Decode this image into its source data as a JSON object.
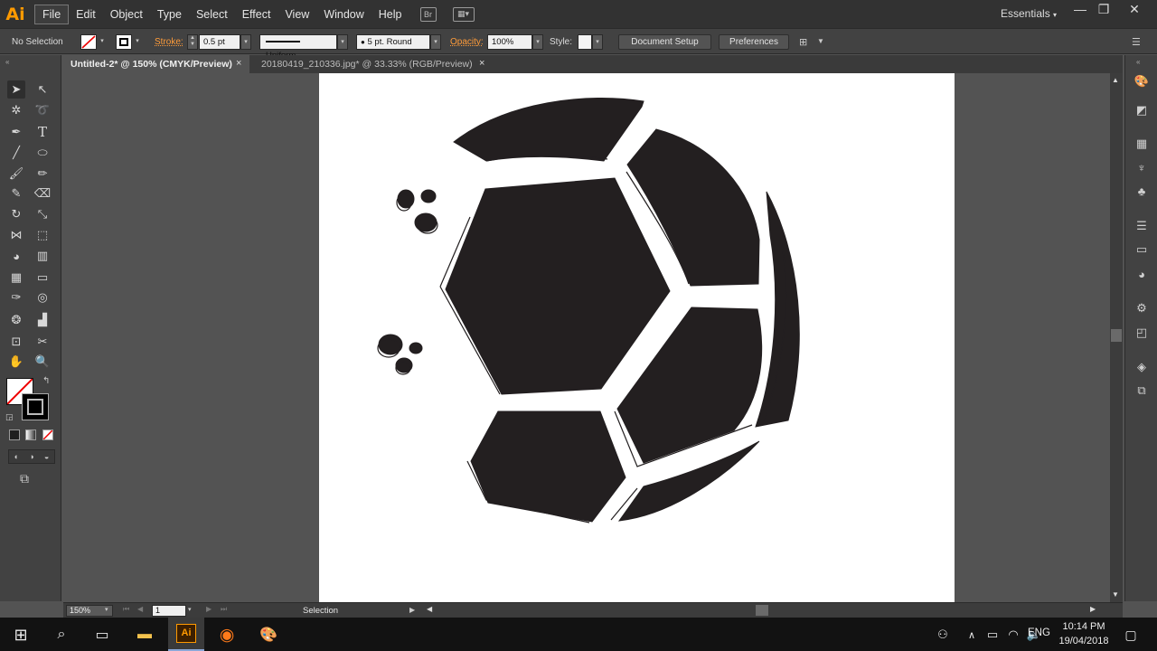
{
  "app": {
    "logo": "Ai",
    "workspace": "Essentials"
  },
  "menu": [
    "File",
    "Edit",
    "Object",
    "Type",
    "Select",
    "Effect",
    "View",
    "Window",
    "Help"
  ],
  "menu_extra": {
    "bridge": "Br"
  },
  "control": {
    "selection": "No Selection",
    "stroke_label": "Stroke:",
    "stroke_value": "0.5 pt",
    "profile": "Uniform",
    "brush": "5 pt. Round",
    "opacity_label": "Opacity:",
    "opacity_value": "100%",
    "style_label": "Style:",
    "document_setup": "Document Setup",
    "preferences": "Preferences"
  },
  "tabs": [
    {
      "label": "Untitled-2* @ 150% (CMYK/Preview)",
      "close": "×"
    },
    {
      "label": "20180419_210336.jpg* @ 33.33% (RGB/Preview)",
      "close": "×"
    }
  ],
  "status": {
    "zoom": "150%",
    "artboard": "1",
    "tool": "Selection"
  },
  "taskbar": {
    "time": "10:14 PM",
    "date": "19/04/2018",
    "lang": "ENG"
  },
  "colors": {
    "fill": "#231f20",
    "accent": "#ff9a00"
  }
}
